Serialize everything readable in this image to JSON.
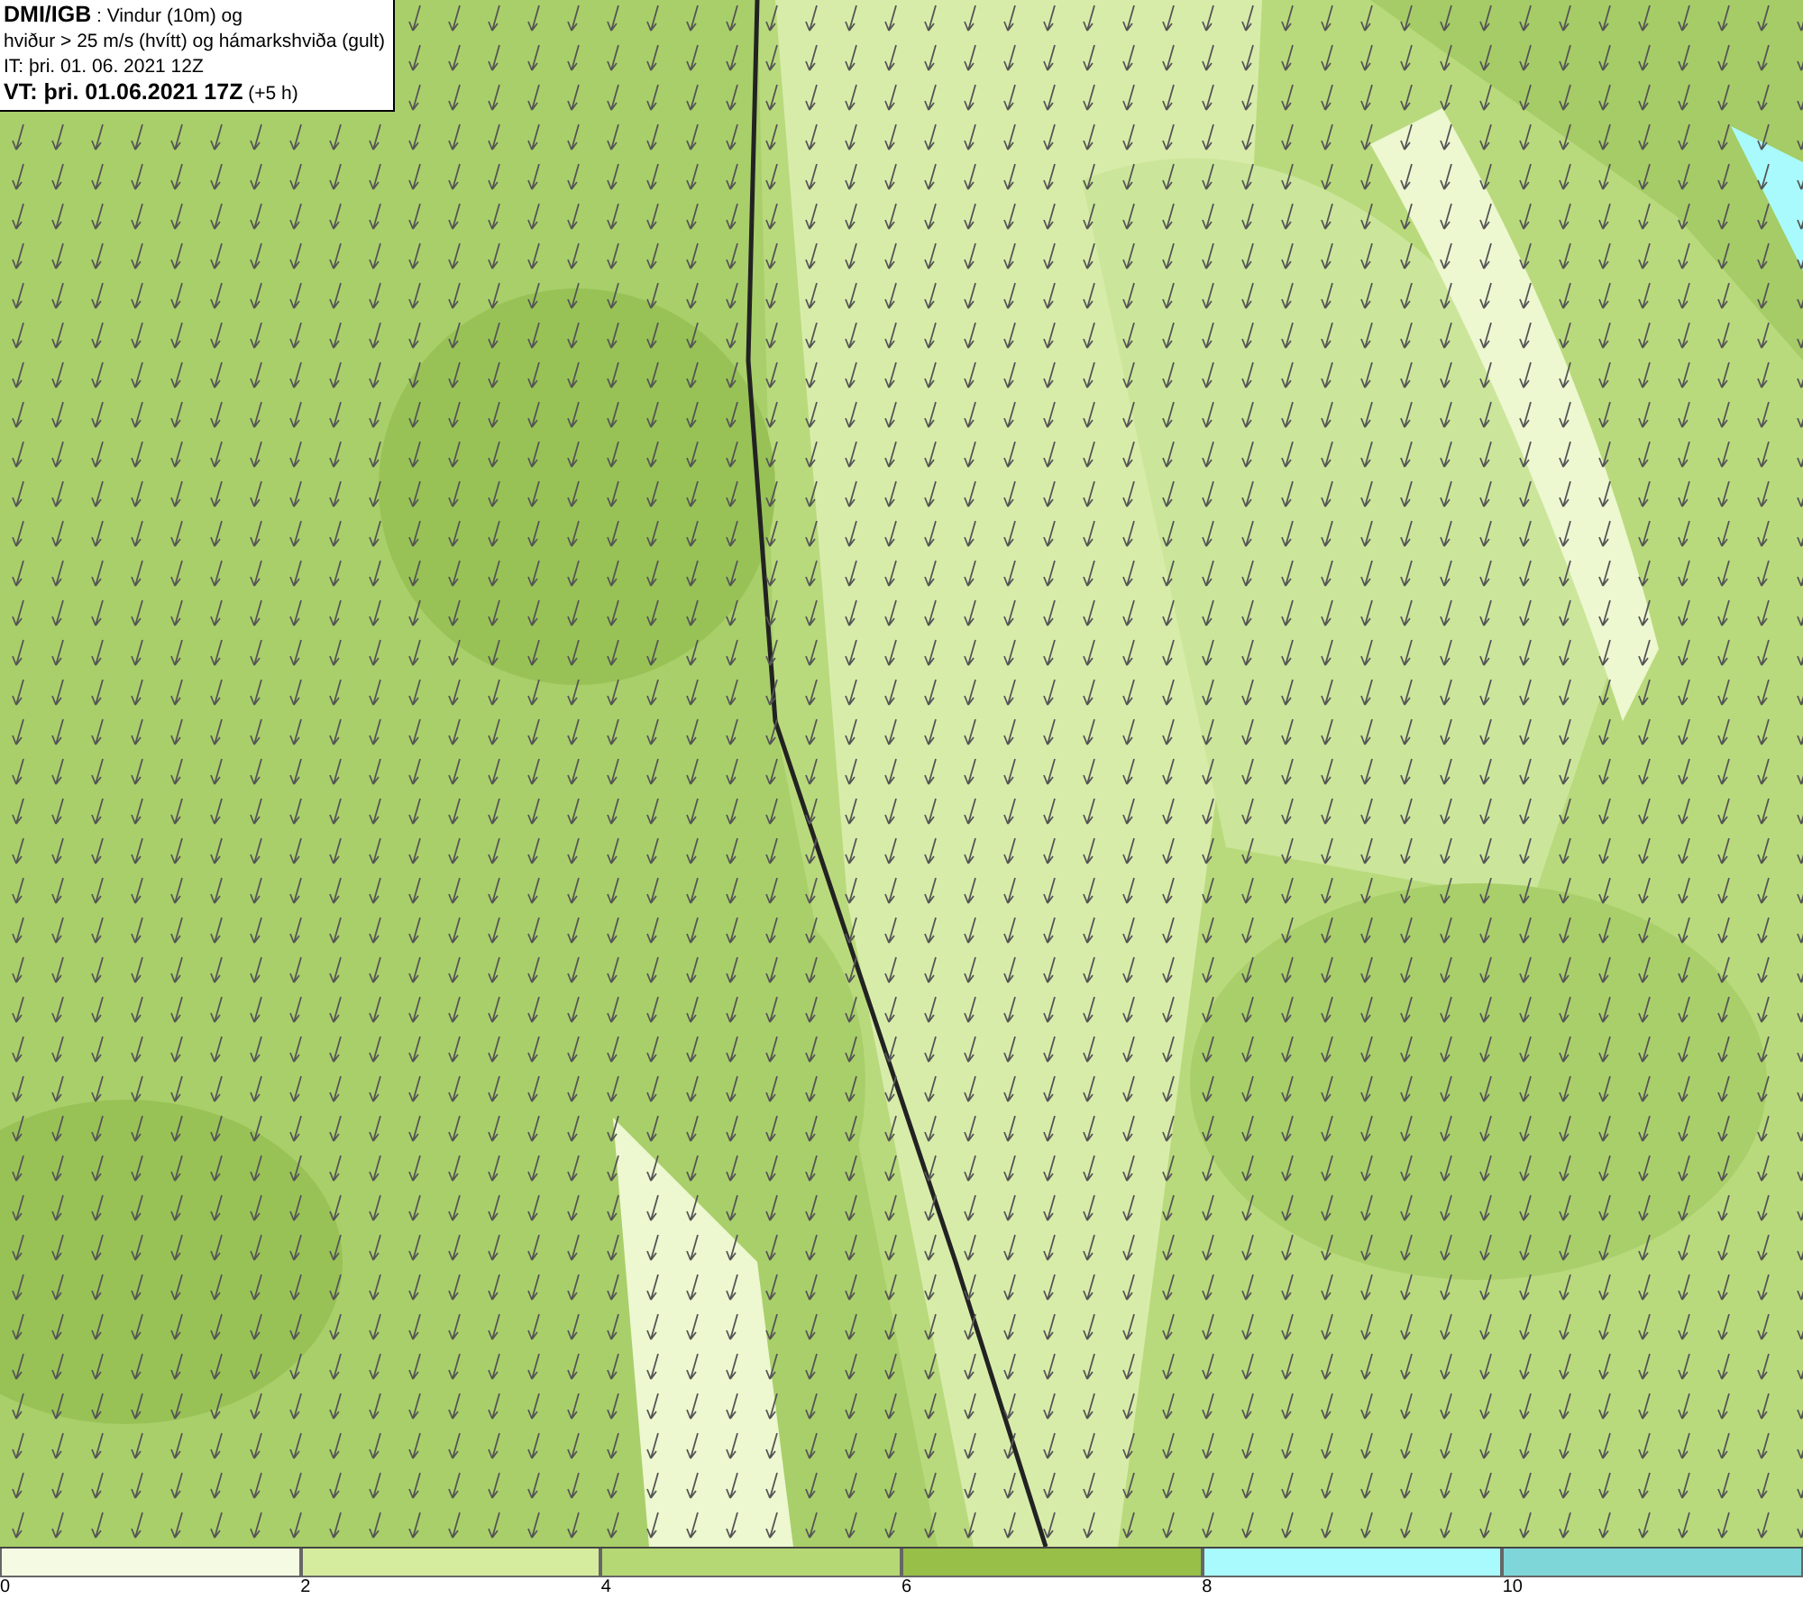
{
  "header": {
    "lines": [
      "**DMI/IGB** : Vindur (10m) og",
      "hviður > 25 m/s (hvítt) og hámarkshviða (gult)",
      "IT: þri. 01. 06. 2021 12Z",
      "**VT: þri. 01.06.2021 17Z** (+5 h)"
    ]
  },
  "legend": {
    "segments": [
      {
        "label": "0",
        "color": "#f5fbe3"
      },
      {
        "label": "2",
        "color": "#d5ec9e"
      },
      {
        "label": "4",
        "color": "#b5d875"
      },
      {
        "label": "6",
        "color": "#98bf48"
      },
      {
        "label": "8",
        "color": "#a8fafc"
      },
      {
        "label": "10",
        "color": "#7ed6d8"
      }
    ]
  }
}
